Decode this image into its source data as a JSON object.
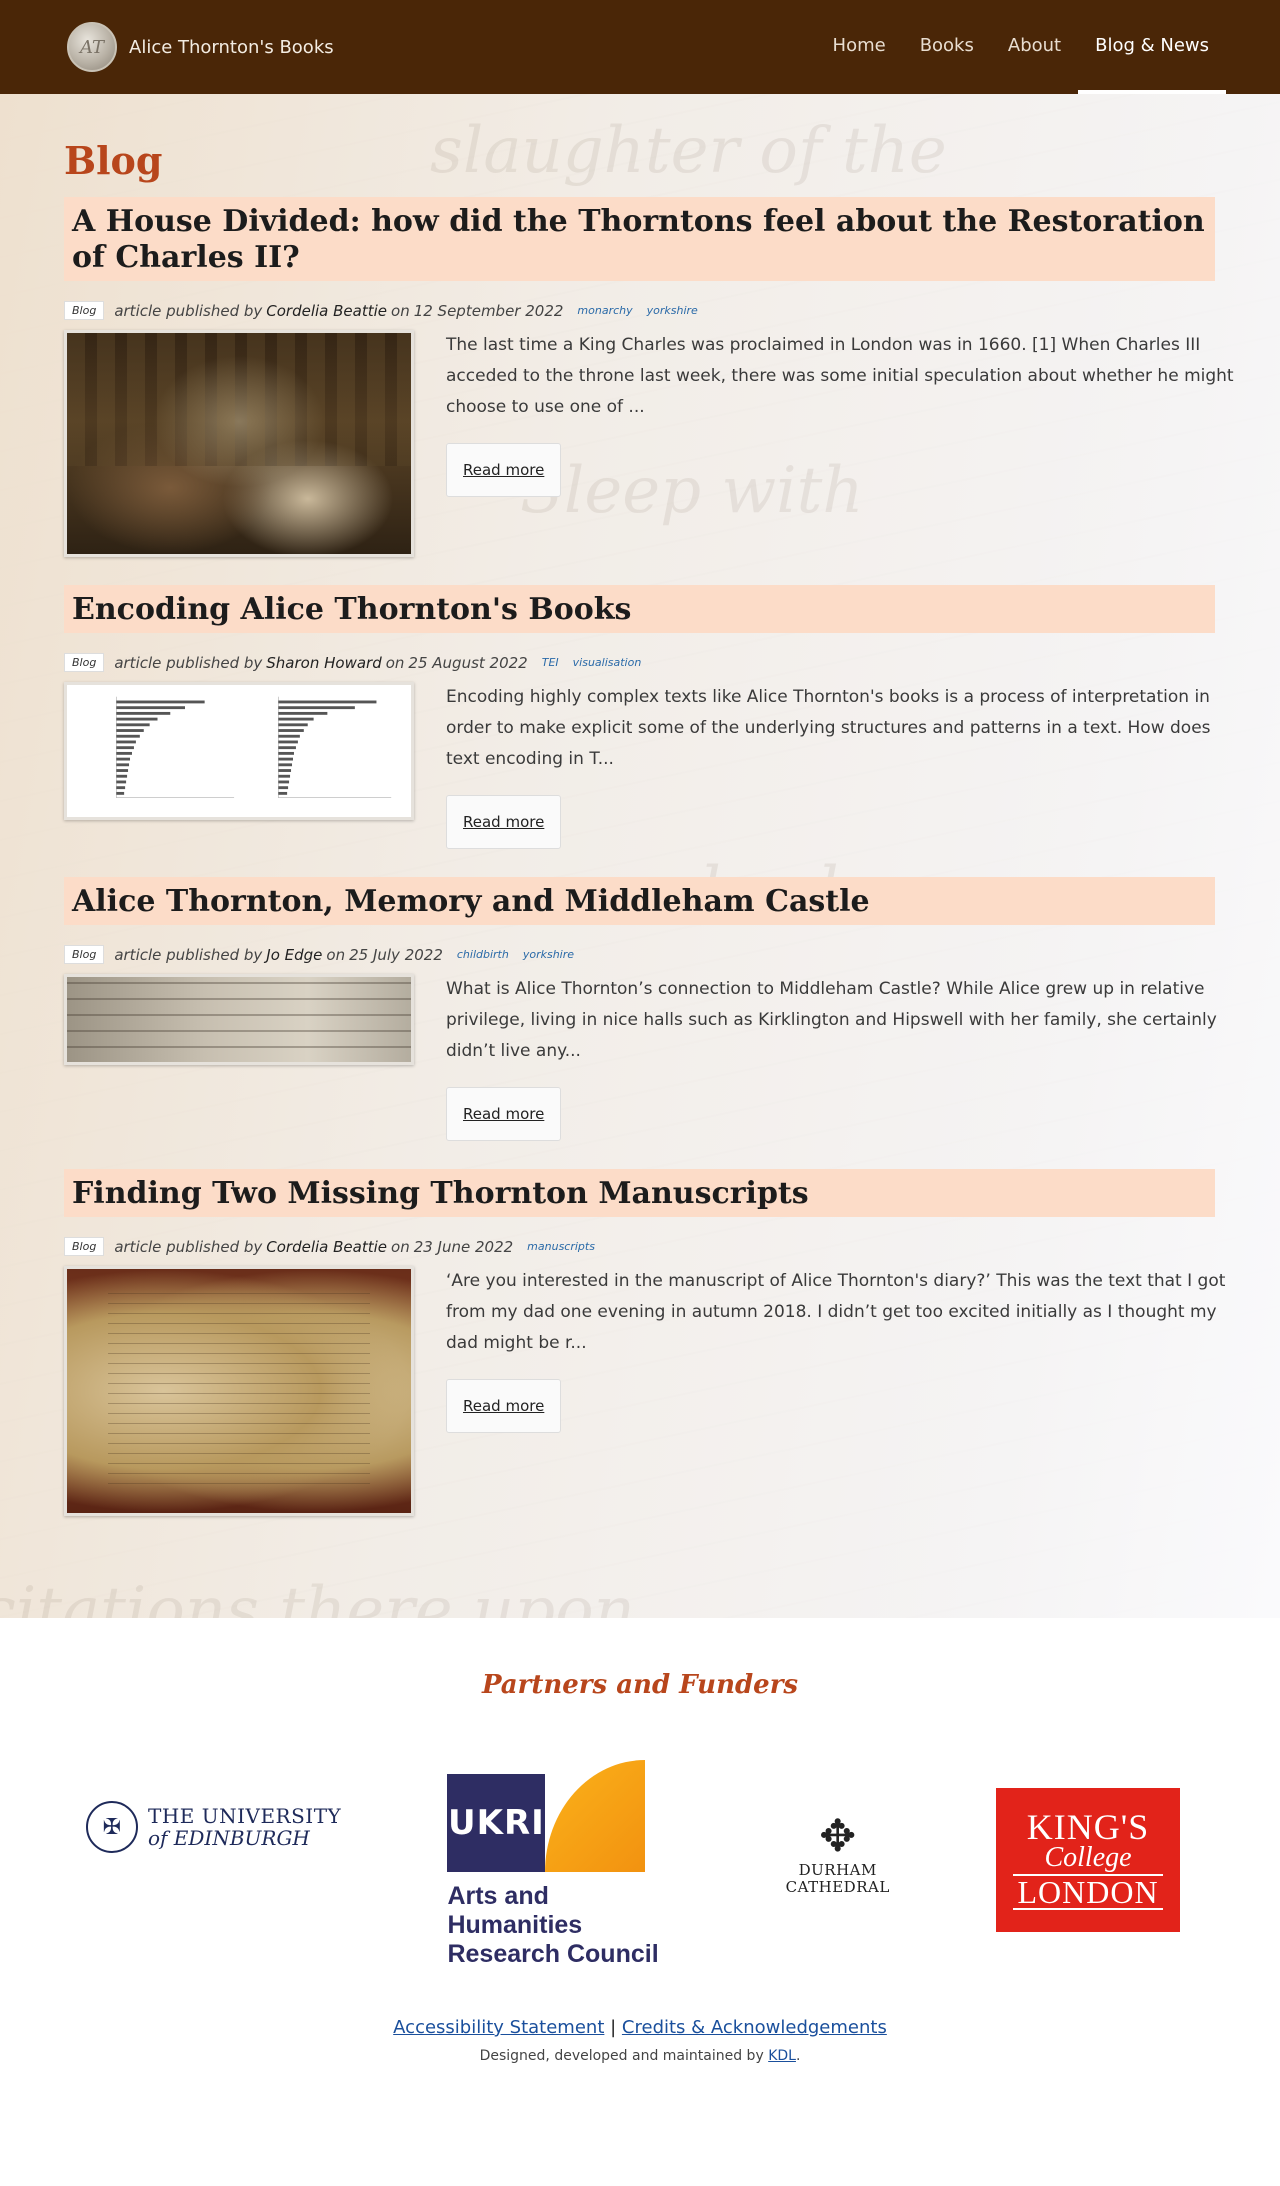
{
  "navbar": {
    "brand_name": "Alice Thornton's Books",
    "links": [
      {
        "label": "Home"
      },
      {
        "label": "Books"
      },
      {
        "label": "About"
      },
      {
        "label": "Blog & News",
        "active": true
      }
    ]
  },
  "page_heading": "Blog",
  "posts": [
    {
      "title": "A House Divided: how did the Thorntons feel about the Restoration of Charles II?",
      "category": "Blog",
      "meta_prefix": "article published by",
      "author": "Cordelia Beattie",
      "meta_on": "on",
      "date": "12 September 2022",
      "tags": [
        "monarchy",
        "yorkshire"
      ],
      "summary": "The last time a King Charles was proclaimed in London was in 1660. [1] When Charles III acceded to the throne last week, there was some initial speculation about whether he might choose to use one of ...",
      "read_more": "Read more",
      "thumbnail": "ball-painting"
    },
    {
      "title": "Encoding Alice Thornton's Books",
      "category": "Blog",
      "meta_prefix": "article published by",
      "author": "Sharon Howard",
      "meta_on": "on",
      "date": "25 August 2022",
      "tags": [
        "TEI",
        "visualisation"
      ],
      "summary": "Encoding highly complex texts like Alice Thornton's books is a process of interpretation in order to make explicit some of the underlying structures and patterns in a text. How does text encoding in T...",
      "read_more": "Read more",
      "thumbnail": "bar-chart-image"
    },
    {
      "title": "Alice Thornton, Memory and Middleham Castle",
      "category": "Blog",
      "meta_prefix": "article published by",
      "author": "Jo Edge",
      "meta_on": "on",
      "date": "25 July 2022",
      "tags": [
        "childbirth",
        "yorkshire"
      ],
      "summary": "What is Alice Thornton’s connection to Middleham Castle? While Alice grew up in relative privilege, living in nice halls such as Kirklington and Hipswell with her family, she certainly didn’t live any...",
      "read_more": "Read more",
      "thumbnail": "manuscript-strip"
    },
    {
      "title": "Finding Two Missing Thornton Manuscripts",
      "category": "Blog",
      "meta_prefix": "article published by",
      "author": "Cordelia Beattie",
      "meta_on": "on",
      "date": "23 June 2022",
      "tags": [
        "manuscripts"
      ],
      "summary": "‘Are you interested in the manuscript of Alice Thornton's diary?’ This was the text that I got from my dad one evening in autumn 2018. I didn’t get too excited initially as I thought my dad might be r...",
      "read_more": "Read more",
      "thumbnail": "open-book-photo"
    }
  ],
  "footer": {
    "partners_title": "Partners and Funders",
    "logos": {
      "edinburgh": {
        "line1": "THE UNIVERSITY",
        "line2": "of EDINBURGH"
      },
      "ukri": {
        "mark": "UKRI",
        "name_lines": [
          "Arts and",
          "Humanities",
          "Research Council"
        ]
      },
      "durham": {
        "line1": "DURHAM",
        "line2": "CATHEDRAL"
      },
      "kings": {
        "line1": "KING'S",
        "line2": "College",
        "line3": "LONDON"
      }
    },
    "links": [
      {
        "label": "Accessibility Statement"
      },
      {
        "label": "Credits & Acknowledgements"
      }
    ],
    "separator": "|",
    "credit_prefix": "Designed, developed and maintained by",
    "credit_link": "KDL",
    "credit_suffix": "."
  },
  "colors": {
    "navbar_bg": "#4a2607",
    "heading_accent": "#b8461c",
    "title_band": "#fcdcc8",
    "tag_link": "#2a6aa8",
    "footer_link": "#1a4f9c"
  }
}
